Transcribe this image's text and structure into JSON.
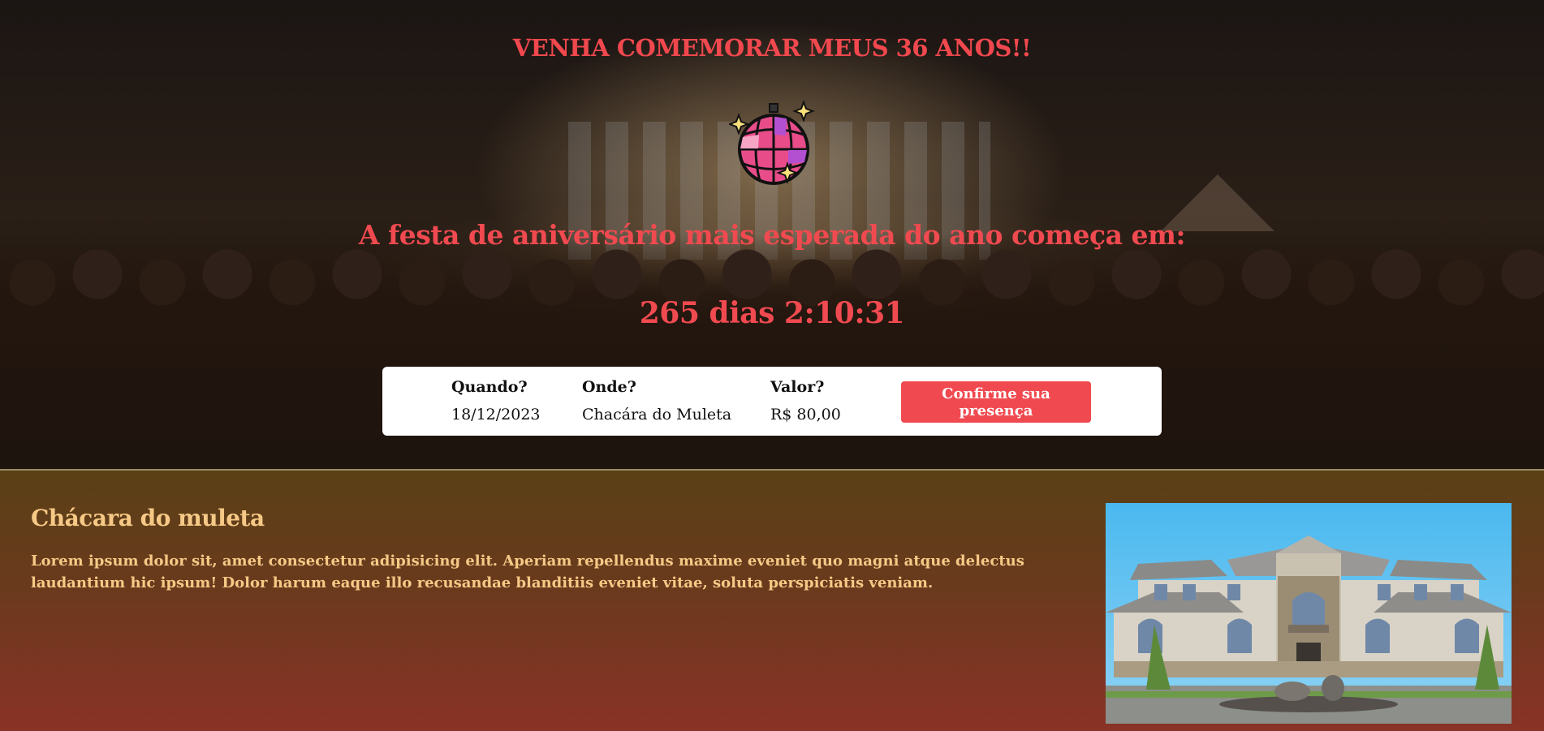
{
  "header": {
    "title": "VENHA COMEMORAR MEUS 36 ANOS!!",
    "subtitle": "A festa de aniversário mais esperada do ano começa em:",
    "countdown": "265 dias 2:10:31"
  },
  "info": {
    "when_label": "Quando?",
    "when_value": "18/12/2023",
    "where_label": "Onde?",
    "where_value": "Chacára do Muleta",
    "price_label": "Valor?",
    "price_value": "R$ 80,00",
    "confirm_label": "Confirme sua presença"
  },
  "venue": {
    "title": "Chácara do muleta",
    "description": "Lorem ipsum dolor sit, amet consectetur adipisicing elit. Aperiam repellendus maxime eveniet quo magni atque delectus laudantium hic ipsum! Dolor harum eaque illo recusandae blanditiis eveniet vitae, soluta perspiciatis veniam."
  },
  "colors": {
    "accent": "#f04a50",
    "venue_text": "#f6c986",
    "card_bg": "#ffffff"
  },
  "icons": {
    "disco": "disco-ball-icon",
    "photo": "house-photo"
  }
}
